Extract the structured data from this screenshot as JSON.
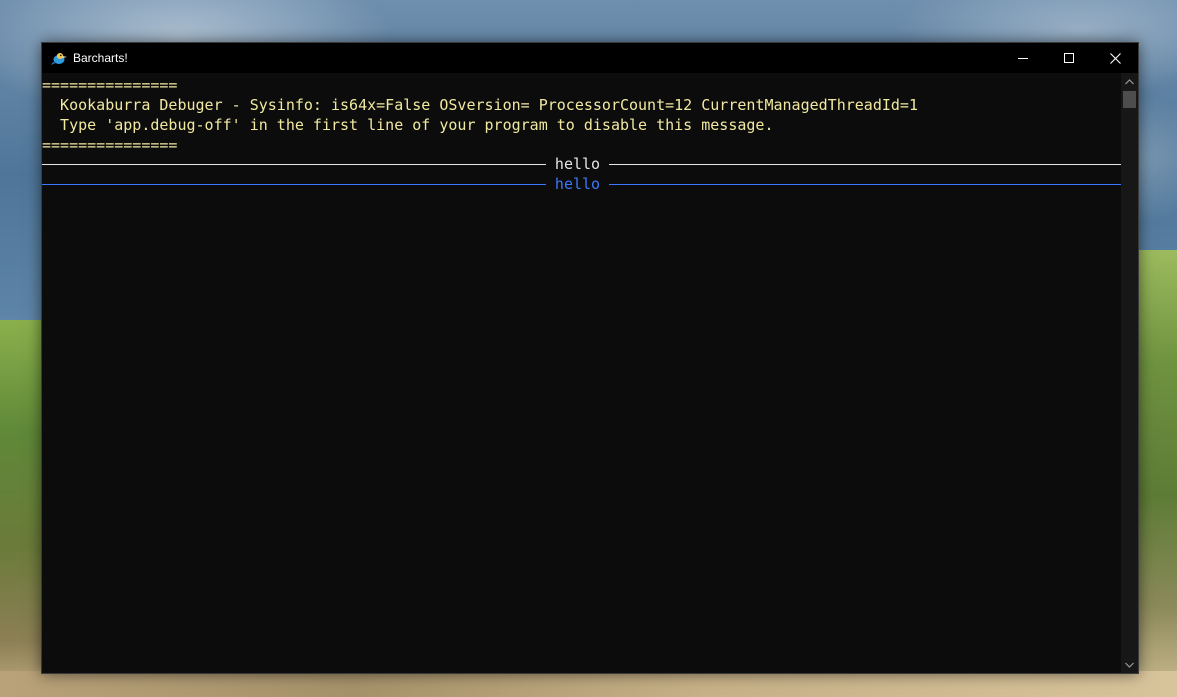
{
  "window": {
    "title": "Barcharts!"
  },
  "console": {
    "lines": [
      "===============",
      "  Kookaburra Debuger - Sysinfo: is64x=False OSversion= ProcessorCount=12 CurrentManagedThreadId=1",
      "  Type 'app.debug-off' in the first line of your program to disable this message.",
      "==============="
    ],
    "rules": [
      {
        "label": "hello",
        "color": "#e6e6e6"
      },
      {
        "label": "hello",
        "color": "#3b78ff"
      }
    ],
    "text_color": "#f2e9a0"
  },
  "icons": {
    "app": "kookaburra-bird-icon",
    "minimize": "minimize-icon",
    "maximize": "maximize-icon",
    "close": "close-icon",
    "scroll_up": "chevron-up-icon",
    "scroll_down": "chevron-down-icon"
  }
}
